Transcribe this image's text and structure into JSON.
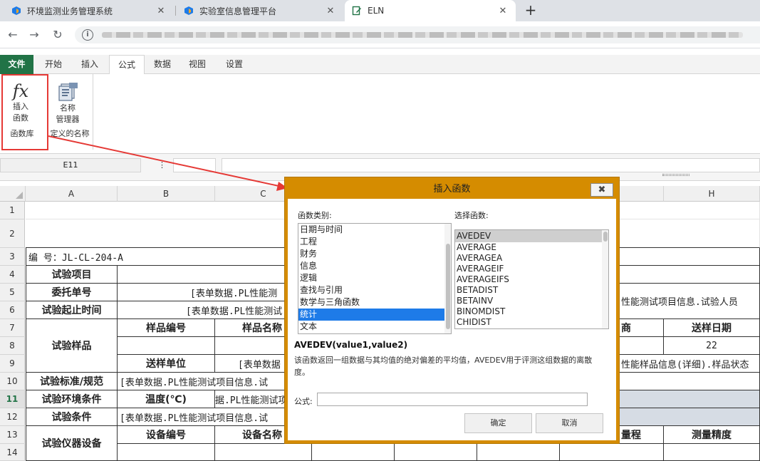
{
  "browser": {
    "tabs": [
      {
        "label": "环境监测业务管理系统",
        "active": false
      },
      {
        "label": "实验室信息管理平台",
        "active": false
      },
      {
        "label": "ELN",
        "active": true
      }
    ],
    "new_tab_icon": "+",
    "close_icon": "✕"
  },
  "ribbon": {
    "file_tab": "文件",
    "tabs": [
      "开始",
      "插入",
      "公式",
      "数据",
      "视图",
      "设置"
    ],
    "active_tab": "公式",
    "insert_function": {
      "line1": "插入",
      "line2": "函数",
      "group": "函数库"
    },
    "name_manager": {
      "line1": "名称",
      "line2": "管理器",
      "group": "定义的名称"
    }
  },
  "formula_bar": {
    "cell_ref": "E11",
    "separator": "⋮"
  },
  "sheet": {
    "columns": [
      "A",
      "B",
      "C",
      "",
      "",
      "",
      "",
      "",
      "H"
    ],
    "rows": [
      "1",
      "2",
      "3",
      "4",
      "5",
      "6",
      "7",
      "8",
      "9",
      "10",
      "11",
      "12",
      "13",
      "14"
    ],
    "selected_row": "11",
    "cells": {
      "r3_a": "编 号：JL-CL-204-A",
      "r4_a": "试验项目",
      "r5_a": "委托单号",
      "r5_b": "[表单数据.PL性能测",
      "r5_g": "性能测试项目信息.试验人员",
      "r6_a": "试验起止时间",
      "r6_b": "[表单数据.PL性能测试",
      "r7_a": "试验样品",
      "r7_b": "样品编号",
      "r7_c": "样品名称",
      "r7_g": "商",
      "r7_h": "送样日期",
      "r8_h": "22",
      "r9_b": "送样单位",
      "r9_c": "[表单数据",
      "r9_g": "性能样品信息(详细).样品状态",
      "r10_a": "试验标准/规范",
      "r10_b": "[表单数据.PL性能测试项目信息.试",
      "r11_a": "试验环境条件",
      "r11_b": "温度(℃)",
      "r11_c": "据.PL性能测试项",
      "r12_a": "试验条件",
      "r12_b": "[表单数据.PL性能测试项目信息.试",
      "r13_a": "试验仪器设备",
      "r13_b": "设备编号",
      "r13_c": "设备名称",
      "r13_g": "量程",
      "r13_h": "测量精度"
    }
  },
  "dialog": {
    "title": "插入函数",
    "close_icon": "✖",
    "category_label": "函数类别:",
    "categories": [
      "日期与时间",
      "工程",
      "财务",
      "信息",
      "逻辑",
      "查找与引用",
      "数学与三角函数",
      "统计",
      "文本"
    ],
    "selected_category": "统计",
    "function_label": "选择函数:",
    "functions": [
      "AVEDEV",
      "AVERAGE",
      "AVERAGEA",
      "AVERAGEIF",
      "AVERAGEIFS",
      "BETADIST",
      "BETAINV",
      "BINOMDIST",
      "CHIDIST"
    ],
    "selected_function": "AVEDEV",
    "signature": "AVEDEV(value1,value2)",
    "description": "该函数返回一组数据与其均值的绝对偏差的平均值，AVEDEV用于评测这组数据的离散度。",
    "formula_label": "公式:",
    "formula_value": "",
    "ok": "确定",
    "cancel": "取消"
  }
}
